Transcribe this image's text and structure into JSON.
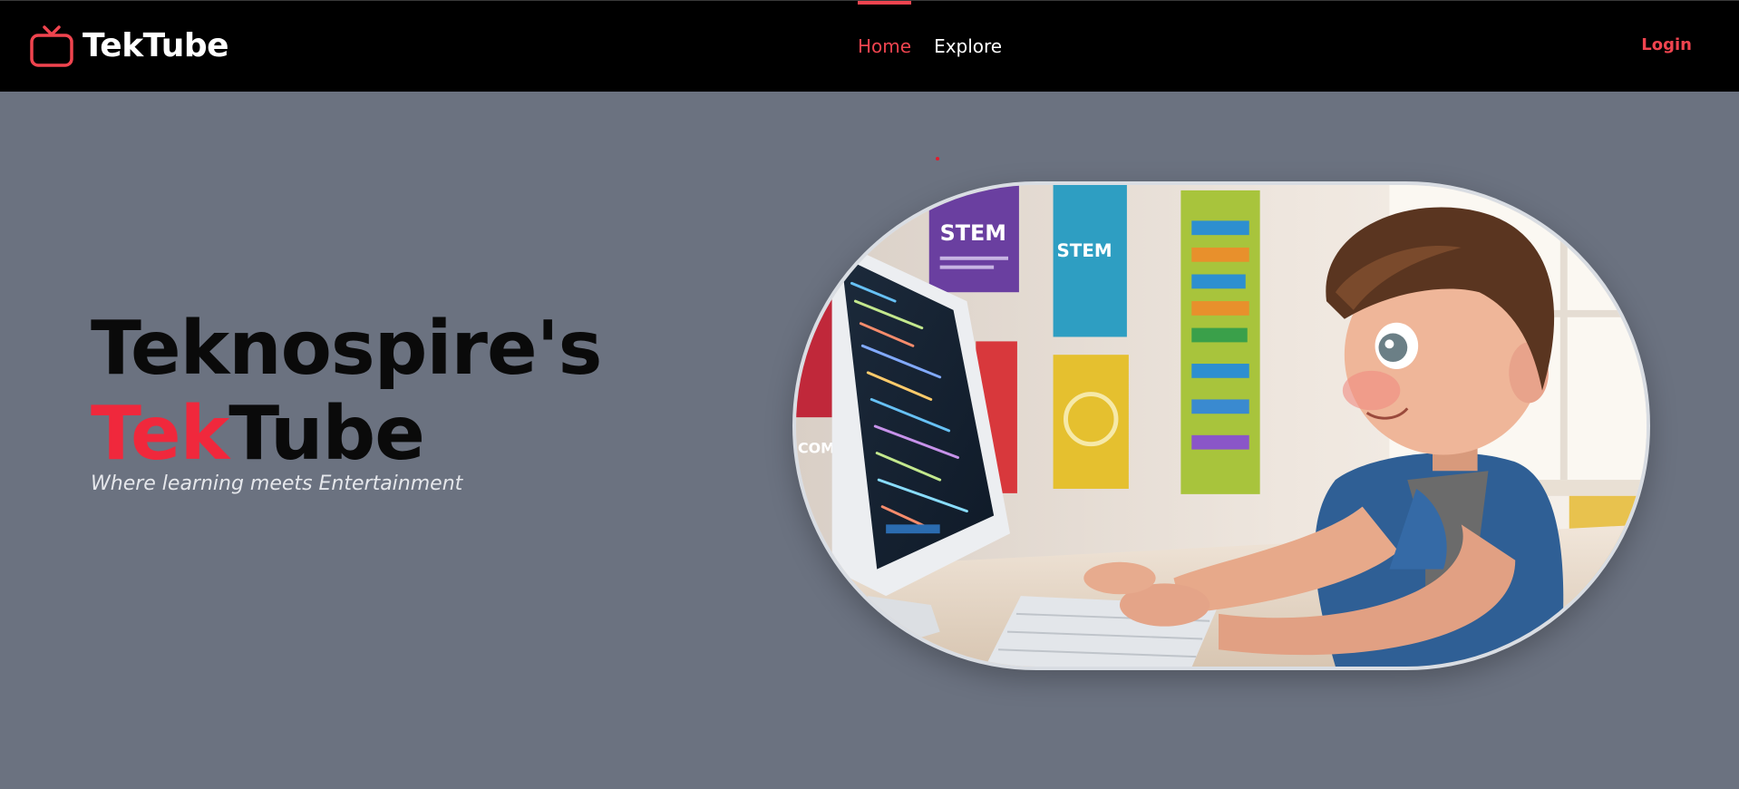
{
  "nav": {
    "brand": "TekTube",
    "links": [
      {
        "label": "Home",
        "active": true
      },
      {
        "label": "Explore",
        "active": false
      }
    ],
    "login": "Login"
  },
  "hero": {
    "title_line1": "Teknospire's",
    "title_accent": "Tek",
    "title_rest": "Tube",
    "tagline": "Where learning meets Entertainment",
    "image": {
      "poster_text_1": "STEM",
      "poster_text_2": "STEM",
      "poster_text_3": "COM"
    }
  },
  "colors": {
    "accent": "#f0444f",
    "navbar_bg": "#000000",
    "page_bg": "#6b7280"
  },
  "icons": {
    "brand_icon": "tv-icon"
  }
}
